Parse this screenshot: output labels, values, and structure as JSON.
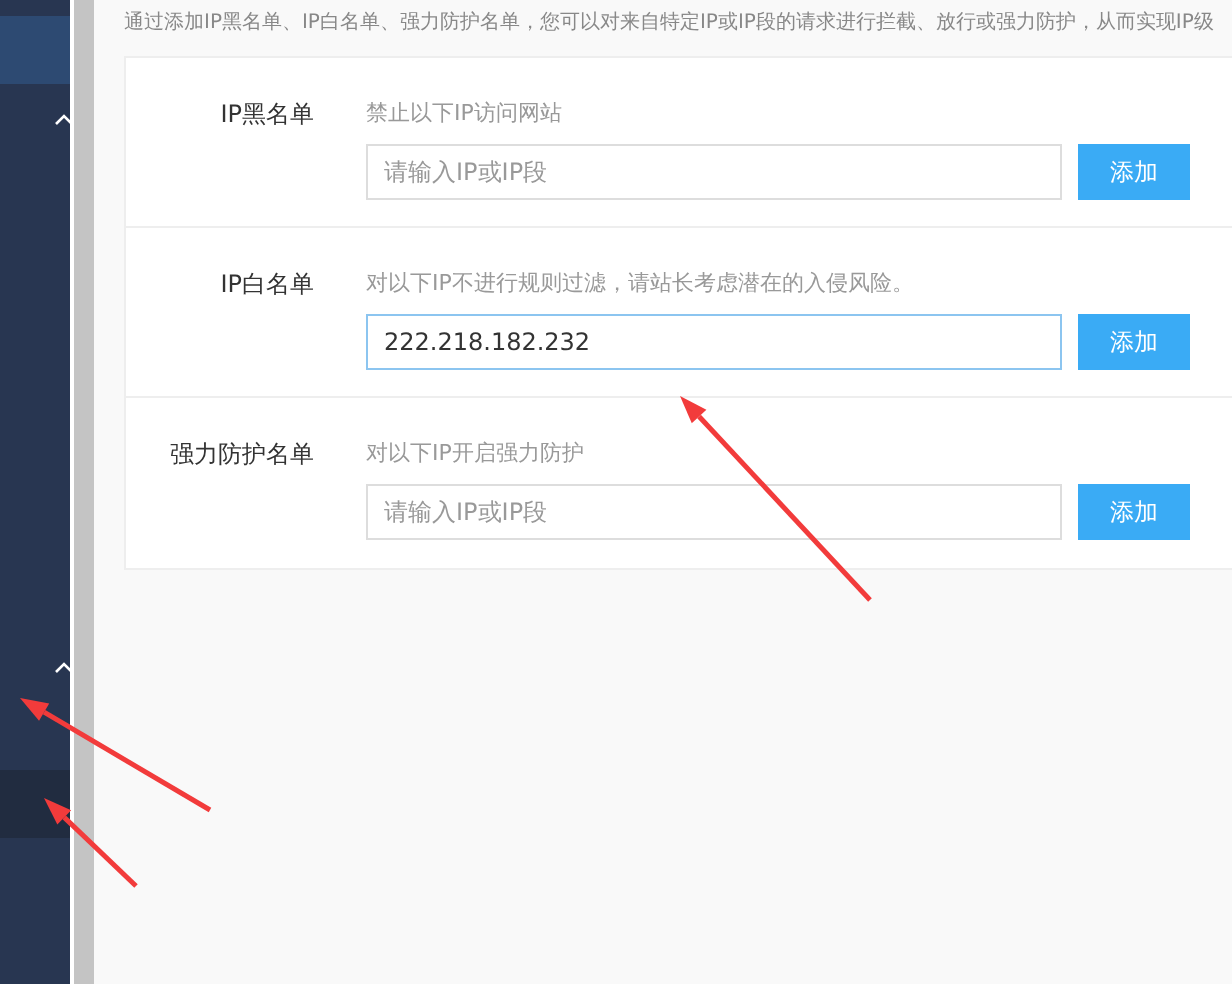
{
  "sidebar": {
    "entries": [
      {
        "kind": "item",
        "selected": true
      },
      {
        "kind": "group",
        "expanded": true
      },
      {
        "kind": "spacer"
      },
      {
        "kind": "group",
        "expanded": true
      },
      {
        "kind": "item",
        "selected": false,
        "hovered": true
      }
    ]
  },
  "description": "通过添加IP黑名单、IP白名单、强力防护名单，您可以对来自特定IP或IP段的请求进行拦截、放行或强力防护，从而实现IP级",
  "lists": [
    {
      "label": "IP黑名单",
      "hint": "禁止以下IP访问网站",
      "placeholder": "请输入IP或IP段",
      "focused": false,
      "button": "添加"
    },
    {
      "label": "IP白名单",
      "hint": "对以下IP不进行规则过滤，请站长考虑潜在的入侵风险。",
      "value": "222.218.182.232",
      "focused": true,
      "button": "添加"
    },
    {
      "label": "强力防护名单",
      "hint": "对以下IP开启强力防护",
      "placeholder": "请输入IP或IP段",
      "focused": false,
      "button": "添加"
    }
  ]
}
